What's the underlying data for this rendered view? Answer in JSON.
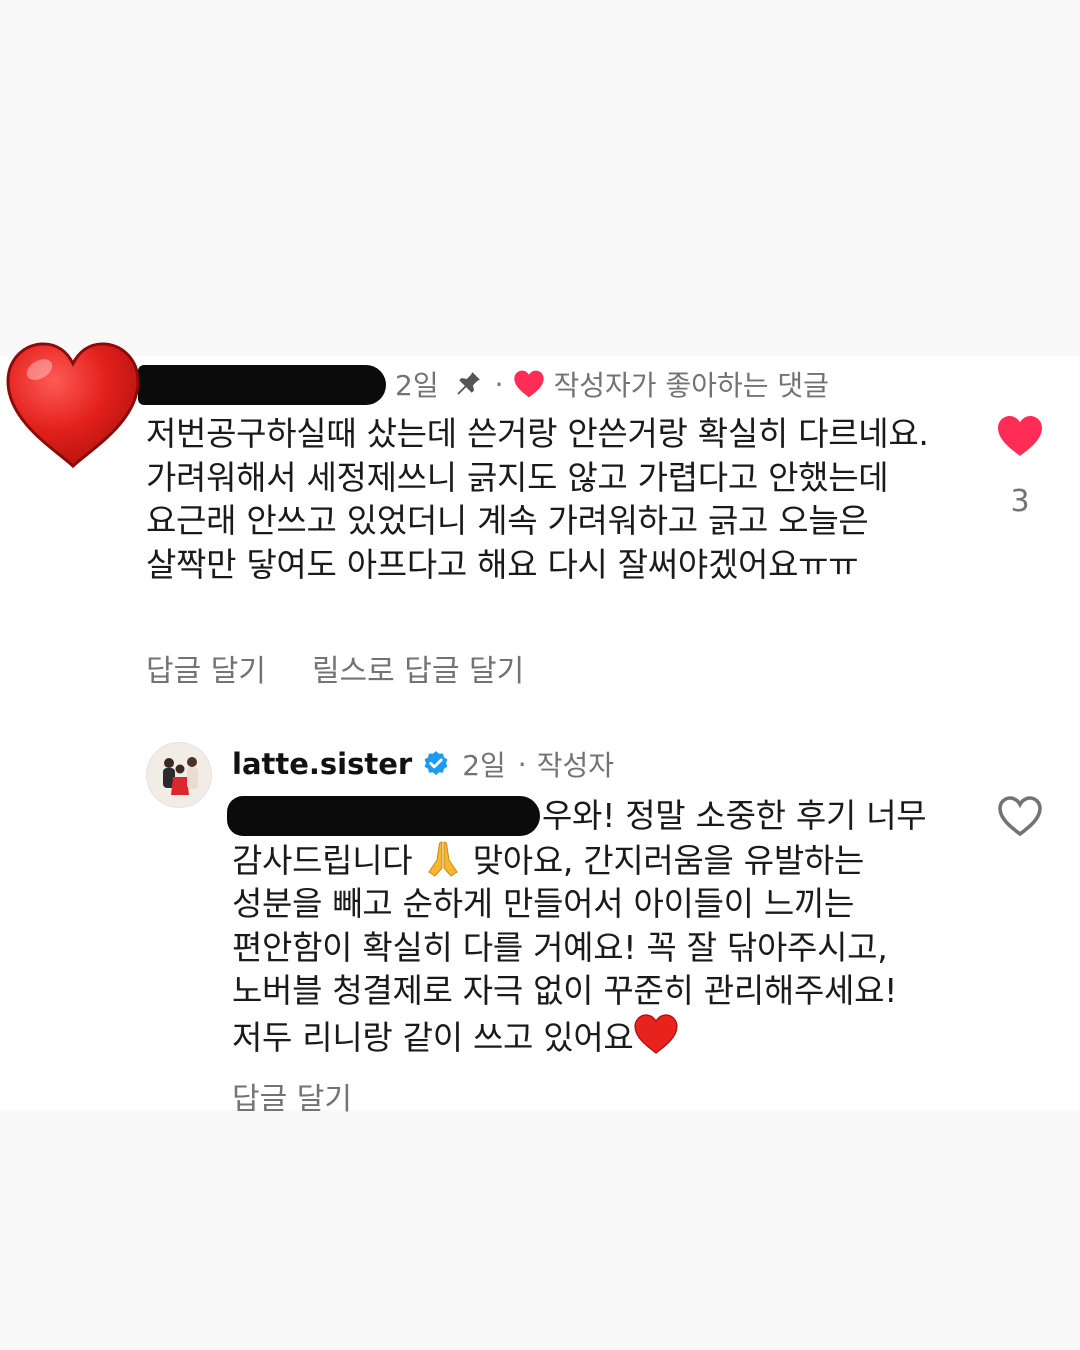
{
  "comment": {
    "time": "2일",
    "dot": "·",
    "author_liked_label": "작성자가 좋아하는 댓글",
    "text": "저번공구하실때 샀는데 쓴거랑 안쓴거랑 확실히 다르네요. 가려워해서 세정제쓰니 긁지도 않고 가렵다고 안했는데 요근래 안쓰고 있었더니 계속 가려워하고 긁고 오늘은 살짝만 닿여도 아프다고 해요 다시 잘써야겠어요ㅠㅠ",
    "like_count": "3",
    "reply_label": "답글 달기",
    "reels_reply_label": "릴스로 답글 달기"
  },
  "reply": {
    "username": "latte.sister",
    "time": "2일",
    "dot": "·",
    "author_label": "작성자",
    "text_part1": "우와! 정말 소중한 후기 너무 감사드립니다 ",
    "text_part2": " 맞아요, 간지러움을 유발하는 성분을 빼고 순하게 만들어서 아이들이 느끼는 편안함이 확실히 다를 거예요! 꼭 잘 닦아주시고, 노버블 청결제로 자극 없이 꾸준히 관리해주세요! 저두 리니랑 같이 쓰고 있어요",
    "reply_label": "답글 달기"
  },
  "icons": {
    "big_heart": "red-heart-icon",
    "pin": "pin-icon",
    "author_heart": "heart-icon",
    "verified": "verified-badge-icon",
    "like_filled": "heart-filled-icon",
    "like_outline": "heart-outline-icon",
    "pray": "folded-hands-icon",
    "heart_emoji": "red-heart-emoji-icon"
  },
  "colors": {
    "like_red": "#ff2d55",
    "verified_blue": "#1d9bf0",
    "muted_gray": "#737373"
  }
}
